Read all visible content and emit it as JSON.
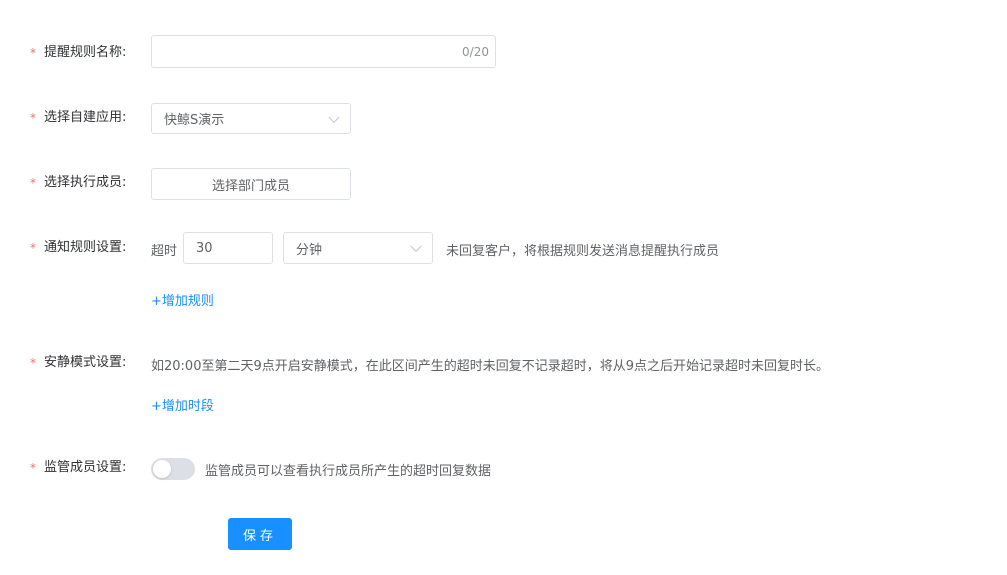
{
  "form": {
    "rule_name": {
      "required_mark": "*",
      "label": "提醒规则名称:",
      "value": "",
      "counter": "0/20"
    },
    "app_select": {
      "required_mark": "*",
      "label": "选择自建应用:",
      "selected": "快鲸S演示",
      "icon": "chevron-down-icon"
    },
    "members": {
      "required_mark": "*",
      "label": "选择执行成员:",
      "button_label": "选择部门成员"
    },
    "notify_rule": {
      "required_mark": "*",
      "label": "通知规则设置:",
      "timeout_prefix": "超时",
      "timeout_value": "30",
      "unit_selected": "分钟",
      "description": "未回复客户，将根据规则发送消息提醒执行成员",
      "add_link": "+增加规则"
    },
    "quiet_mode": {
      "required_mark": "*",
      "label": "安静模式设置:",
      "description": "如20:00至第二天9点开启安静模式，在此区间产生的超时未回复不记录超时，将从9点之后开始记录超时未回复时长。",
      "add_link": "+增加时段"
    },
    "supervisor": {
      "required_mark": "*",
      "label": "监管成员设置:",
      "switch_on": false,
      "description": "监管成员可以查看执行成员所产生的超时回复数据"
    },
    "save_label": "保存"
  },
  "colors": {
    "primary": "#1890ff",
    "required": "#f56c6c",
    "border": "#dcdfe6",
    "switch_off": "#dcdfe6"
  }
}
